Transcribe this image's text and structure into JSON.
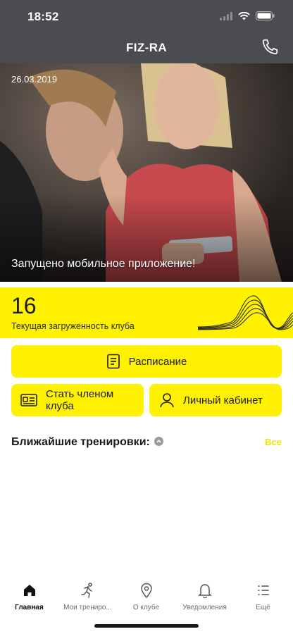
{
  "status_bar": {
    "time": "18:52"
  },
  "header": {
    "title": "FIZ-RA",
    "call_icon": "phone-icon"
  },
  "news": {
    "date": "26.03.2019",
    "caption": "Запущено мобильное приложение!"
  },
  "club_load": {
    "value": "16",
    "label": "Текущая загруженность клуба",
    "accent": "#fff100"
  },
  "actions": {
    "schedule": {
      "label": "Расписание",
      "icon": "document-icon"
    },
    "become_member": {
      "label": "Стать членом клуба",
      "icon": "id-card-icon"
    },
    "personal_cabinet": {
      "label": "Личный кабинет",
      "icon": "person-icon"
    }
  },
  "upcoming": {
    "title": "Ближайшие тренировки:",
    "see_all": "Все"
  },
  "tabbar": {
    "items": [
      {
        "label": "Главная",
        "icon": "home-icon",
        "active": true
      },
      {
        "label": "Мои трениро...",
        "icon": "runner-icon",
        "active": false
      },
      {
        "label": "О клубе",
        "icon": "location-pin-icon",
        "active": false
      },
      {
        "label": "Уведомления",
        "icon": "bell-icon",
        "active": false
      },
      {
        "label": "Ещё",
        "icon": "list-icon",
        "active": false
      }
    ]
  }
}
